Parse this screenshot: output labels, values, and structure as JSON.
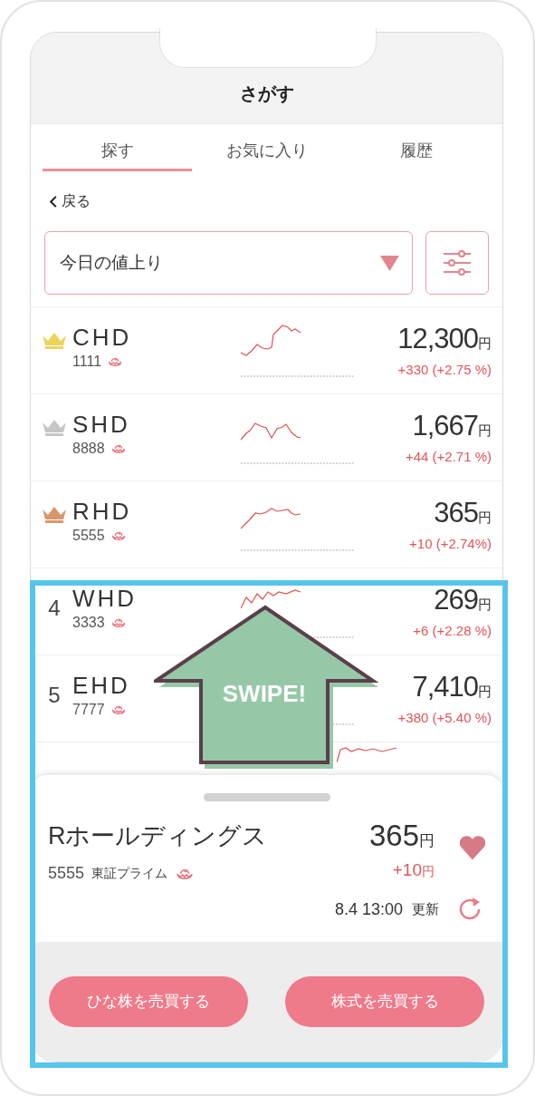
{
  "header": {
    "title": "さがす"
  },
  "tabs": [
    {
      "label": "探す",
      "selected": true
    },
    {
      "label": "お気に入り",
      "selected": false
    },
    {
      "label": "履歴",
      "selected": false
    }
  ],
  "back": {
    "label": "戻る"
  },
  "filter": {
    "value": "今日の値上り"
  },
  "stocks": [
    {
      "rank": {
        "kind": "crown",
        "color": "#eed35a"
      },
      "ticker": "CHD",
      "code": "1111",
      "price": "12,300",
      "unit": "円",
      "change": "+330 (+2.75 %)"
    },
    {
      "rank": {
        "kind": "crown",
        "color": "#c6c6c6"
      },
      "ticker": "SHD",
      "code": "8888",
      "price": "1,667",
      "unit": "円",
      "change": "+44 (+2.71 %)"
    },
    {
      "rank": {
        "kind": "crown",
        "color": "#d8966c"
      },
      "ticker": "RHD",
      "code": "5555",
      "price": "365",
      "unit": "円",
      "change": "+10 (+2.74%)"
    },
    {
      "rank": {
        "kind": "number",
        "label": "4"
      },
      "ticker": "WHD",
      "code": "3333",
      "price": "269",
      "unit": "円",
      "change": "+6 (+2.28 %)"
    },
    {
      "rank": {
        "kind": "number",
        "label": "5"
      },
      "ticker": "EHD",
      "code": "7777",
      "price": "7,410",
      "unit": "円",
      "change": "+380 (+5.40 %)"
    }
  ],
  "overlay": {
    "label": "SWIPE!"
  },
  "sheet": {
    "name": "Rホールディングス",
    "price": "365",
    "price_unit": "円",
    "code": "5555",
    "market": "東証プライム",
    "change": "+10",
    "change_unit": "円",
    "updated": "8.4 13:00",
    "updated_label": "更新",
    "favorite": true
  },
  "buttons": [
    "ひな株を売買する",
    "株式を売買する"
  ]
}
